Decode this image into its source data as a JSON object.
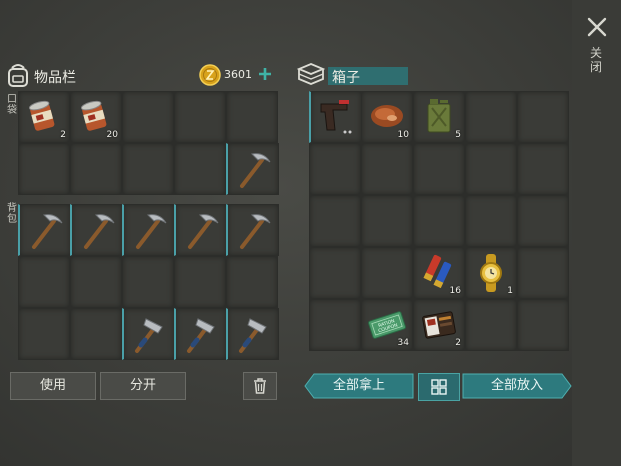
{
  "inventory": {
    "title": "物品栏",
    "coins": "3601",
    "add_icon": "plus-icon",
    "pocket_label": "口袋",
    "backpack_label": "背包",
    "pocket_slots": [
      {
        "icon": "tin-can-icon",
        "count": "2"
      },
      {
        "icon": "tin-can-icon",
        "count": "20"
      },
      {
        "icon": "",
        "count": ""
      },
      {
        "icon": "",
        "count": ""
      },
      {
        "icon": "",
        "count": ""
      },
      {
        "icon": "",
        "count": ""
      },
      {
        "icon": "",
        "count": ""
      },
      {
        "icon": "",
        "count": ""
      },
      {
        "icon": "",
        "count": ""
      },
      {
        "icon": "pickaxe-icon",
        "count": ""
      }
    ],
    "backpack_slots": [
      {
        "icon": "pickaxe-icon",
        "count": ""
      },
      {
        "icon": "pickaxe-icon",
        "count": ""
      },
      {
        "icon": "pickaxe-icon",
        "count": ""
      },
      {
        "icon": "pickaxe-icon",
        "count": ""
      },
      {
        "icon": "pickaxe-icon",
        "count": ""
      },
      {
        "icon": "",
        "count": ""
      },
      {
        "icon": "",
        "count": ""
      },
      {
        "icon": "",
        "count": ""
      },
      {
        "icon": "",
        "count": ""
      },
      {
        "icon": "",
        "count": ""
      },
      {
        "icon": "",
        "count": ""
      },
      {
        "icon": "",
        "count": ""
      },
      {
        "icon": "hammer-icon",
        "count": ""
      },
      {
        "icon": "hammer-icon",
        "count": ""
      },
      {
        "icon": "hammer-icon",
        "count": ""
      }
    ],
    "use_label": "使用",
    "split_label": "分开",
    "trash_icon": "trash-icon"
  },
  "box": {
    "title": "箱子",
    "slots": [
      {
        "icon": "pistol-icon",
        "count": ""
      },
      {
        "icon": "meat-icon",
        "count": "10"
      },
      {
        "icon": "jerrycan-icon",
        "count": "5"
      },
      {
        "icon": "",
        "count": ""
      },
      {
        "icon": "",
        "count": ""
      },
      {
        "icon": "",
        "count": ""
      },
      {
        "icon": "",
        "count": ""
      },
      {
        "icon": "",
        "count": ""
      },
      {
        "icon": "",
        "count": ""
      },
      {
        "icon": "",
        "count": ""
      },
      {
        "icon": "",
        "count": ""
      },
      {
        "icon": "",
        "count": ""
      },
      {
        "icon": "",
        "count": ""
      },
      {
        "icon": "",
        "count": ""
      },
      {
        "icon": "",
        "count": ""
      },
      {
        "icon": "",
        "count": ""
      },
      {
        "icon": "",
        "count": ""
      },
      {
        "icon": "shells-icon",
        "count": "16"
      },
      {
        "icon": "watch-icon",
        "count": "1"
      },
      {
        "icon": "",
        "count": ""
      },
      {
        "icon": "",
        "count": ""
      },
      {
        "icon": "coupon-icon",
        "count": "34"
      },
      {
        "icon": "wallet-icon",
        "count": "2"
      },
      {
        "icon": "",
        "count": ""
      },
      {
        "icon": "",
        "count": ""
      }
    ],
    "coupon_text": [
      "RATION",
      "COUPON"
    ],
    "take_all_label": "全部拿上",
    "put_all_label": "全部放入",
    "sort_icon": "grid-sort-icon"
  },
  "close_label": "关闭",
  "colors": {
    "accent": "#2f7f84",
    "coin": "#e0b020",
    "teal_text": "#eaf6f4"
  }
}
